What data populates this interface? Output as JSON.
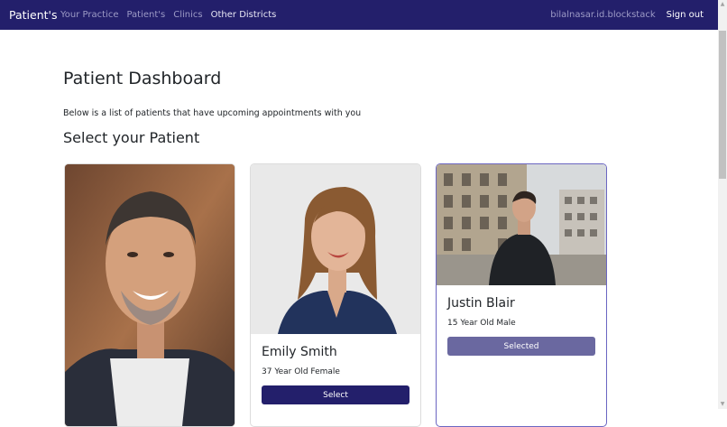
{
  "nav": {
    "brand": "Patient's",
    "links": [
      "Your Practice",
      "Patient's",
      "Clinics",
      "Other Districts"
    ],
    "user": "bilalnasar.id.blockstack",
    "sign_out": "Sign out"
  },
  "page": {
    "title": "Patient Dashboard",
    "subtitle": "Below is a list of patients that have upcoming appointments with you",
    "select_heading": "Select your Patient"
  },
  "patients": [
    {
      "name": "",
      "description": "",
      "button": ""
    },
    {
      "name": "Emily Smith",
      "description": "37 Year Old Female",
      "button": "Select"
    },
    {
      "name": "Justin Blair",
      "description": "15 Year Old Male",
      "button": "Selected"
    }
  ],
  "colors": {
    "nav_bg": "#231f6b",
    "select_btn": "#231f6b",
    "selected_btn": "#6a68a0",
    "selected_border": "#6b66c2"
  }
}
